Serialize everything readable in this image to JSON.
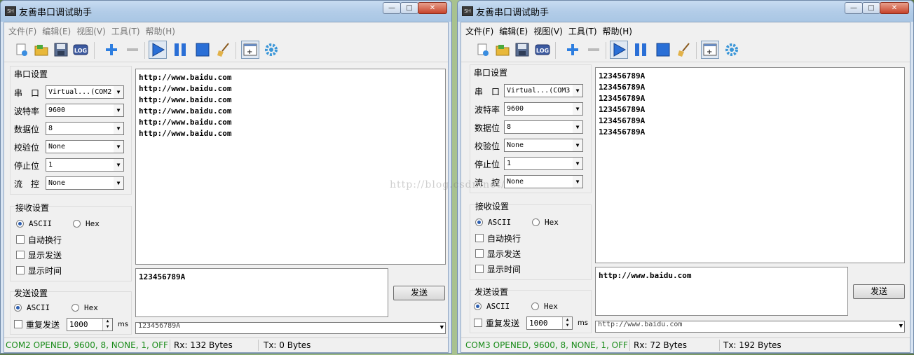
{
  "app_title": "友善串口调试助手",
  "menus": [
    "文件(F)",
    "编辑(E)",
    "视图(V)",
    "工具(T)",
    "帮助(H)"
  ],
  "labels": {
    "serial_settings": "串口设置",
    "port": "串　口",
    "baud": "波特率",
    "data_bits": "数据位",
    "parity": "校验位",
    "stop_bits": "停止位",
    "flow": "流　控",
    "recv_settings": "接收设置",
    "send_settings": "发送设置",
    "ascii": "ASCII",
    "hex": "Hex",
    "auto_wrap": "自动换行",
    "show_send": "显示发送",
    "show_time": "显示时间",
    "repeat_send": "重复发送",
    "ms": "ms",
    "send_button": "发送",
    "log_icon_text": "LOG"
  },
  "windows": [
    {
      "port_value": "Virtual...(COM2",
      "baud_value": "9600",
      "data_bits_value": "8",
      "parity_value": "None",
      "stop_bits_value": "1",
      "flow_value": "None",
      "receive_lines": [
        "http://www.baidu.com",
        "http://www.baidu.com",
        "http://www.baidu.com",
        "http://www.baidu.com",
        "http://www.baidu.com",
        "http://www.baidu.com"
      ],
      "send_text": "123456789A",
      "history_text": "123456789A",
      "repeat_interval": "1000",
      "status_open": "COM2 OPENED, 9600, 8, NONE, 1, OFF",
      "status_rx": "Rx: 132 Bytes",
      "status_tx": "Tx: 0 Bytes"
    },
    {
      "port_value": "Virtual...(COM3",
      "baud_value": "9600",
      "data_bits_value": "8",
      "parity_value": "None",
      "stop_bits_value": "1",
      "flow_value": "None",
      "receive_lines": [
        "123456789A",
        "123456789A",
        "123456789A",
        "123456789A",
        "123456789A",
        "123456789A"
      ],
      "send_text": "http://www.baidu.com",
      "history_text": "http://www.baidu.com",
      "repeat_interval": "1000",
      "status_open": "COM3 OPENED, 9600, 8, NONE, 1, OFF",
      "status_rx": "Rx: 72 Bytes",
      "status_tx": "Tx: 192 Bytes"
    }
  ],
  "watermark": "http://blog.csdn.net/",
  "colors": {
    "status_green": "#1a8c1a",
    "play_blue": "#2a6fd6"
  }
}
